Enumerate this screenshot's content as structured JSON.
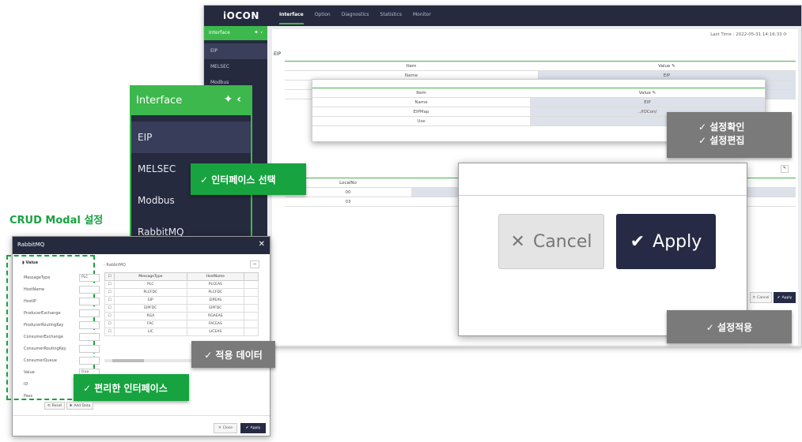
{
  "app": {
    "logo": "iOCON",
    "nav": [
      "Interface",
      "Option",
      "Diagnostics",
      "Statistics",
      "Monitor"
    ],
    "sidebar_title": "Interface",
    "sidebar_items": [
      "EIP",
      "MELSEC",
      "Modbus"
    ],
    "last_time": "Last Time : 2022-05-31 14:16:33",
    "section_title": "EIP",
    "table_headers": [
      "Item",
      "Value"
    ],
    "table_rows": [
      [
        "Name",
        "EIP"
      ]
    ],
    "local_header": "LocalNo",
    "local_rows": [
      "00",
      "03"
    ],
    "cancel_label": "Cancel",
    "apply_label": "Apply"
  },
  "bigside": {
    "title": "Interface",
    "items": [
      "EIP",
      "MELSEC",
      "Modbus",
      "RabbitMQ"
    ]
  },
  "zoomtable": {
    "headers": [
      "Item",
      "Value"
    ],
    "rows": [
      [
        "Name",
        "EIP"
      ],
      [
        "EIPMap",
        "../IOCon/"
      ],
      [
        "Use",
        ""
      ]
    ]
  },
  "labels": {
    "interface_select": "✓ 인터페이스 선택",
    "confirm": "✓ 설정확인",
    "edit": "✓ 설정편집",
    "apply_setting": "✓ 설정적용",
    "apply_data": "✓ 적용 데이터",
    "convenient": "✓ 편리한 인터페이스",
    "crud_title": "CRUD Modal 설정"
  },
  "bigbuttons": {
    "cancel": "Cancel",
    "apply": "Apply"
  },
  "modal": {
    "title": "RabbitMQ",
    "value_section": "Value",
    "fields": [
      {
        "label": "MessageType",
        "value": "PLC"
      },
      {
        "label": "HostName",
        "value": ""
      },
      {
        "label": "HostIP",
        "value": ""
      },
      {
        "label": "ProducerExchange",
        "value": ""
      },
      {
        "label": "ProducerRoutingKey",
        "value": ""
      },
      {
        "label": "ConsumerExchange",
        "value": ""
      },
      {
        "label": "ConsumerRoutingKey",
        "value": ""
      },
      {
        "label": "ConsumerQueue",
        "value": ""
      },
      {
        "label": "Value",
        "value": "true"
      },
      {
        "label": "ID",
        "value": ""
      },
      {
        "label": "Pass",
        "value": ""
      }
    ],
    "breadcrumb": "- RabbitMQ",
    "table_headers": [
      "MessageType",
      "HostName"
    ],
    "table_rows": [
      [
        "PLC",
        "PLCEAS"
      ],
      [
        "PLCFDC",
        "PLCFDC"
      ],
      [
        "EIP",
        "EIPEAS"
      ],
      [
        "EIPFDC",
        "EIPFDC"
      ],
      [
        "RGA",
        "RGAEAS"
      ],
      [
        "FAC",
        "FACEAS"
      ],
      [
        "LIC",
        "LICEAS"
      ]
    ],
    "reset_label": "Reset",
    "add_label": "Add Data",
    "close_label": "Close",
    "apply_label": "Apply"
  }
}
